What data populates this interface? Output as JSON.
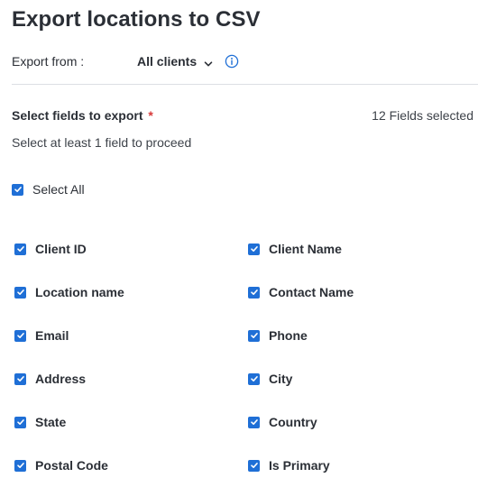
{
  "page": {
    "title": "Export locations to CSV"
  },
  "export_from": {
    "label": "Export from :",
    "selected_value": "All clients"
  },
  "fields_section": {
    "heading": "Select fields to export",
    "required_marker": "*",
    "selected_count": "12 Fields selected",
    "hint": "Select at least 1 field to proceed",
    "select_all": {
      "label": "Select All",
      "checked": true
    },
    "fields": [
      {
        "label": "Client ID",
        "checked": true
      },
      {
        "label": "Client Name",
        "checked": true
      },
      {
        "label": "Location name",
        "checked": true
      },
      {
        "label": "Contact Name",
        "checked": true
      },
      {
        "label": "Email",
        "checked": true
      },
      {
        "label": "Phone",
        "checked": true
      },
      {
        "label": "Address",
        "checked": true
      },
      {
        "label": "City",
        "checked": true
      },
      {
        "label": "State",
        "checked": true
      },
      {
        "label": "Country",
        "checked": true
      },
      {
        "label": "Postal Code",
        "checked": true
      },
      {
        "label": "Is Primary",
        "checked": true
      }
    ]
  },
  "colors": {
    "accent": "#1f6fd6",
    "required": "#d83a3a",
    "text": "#2b2f36",
    "divider": "#dcdfe4"
  }
}
